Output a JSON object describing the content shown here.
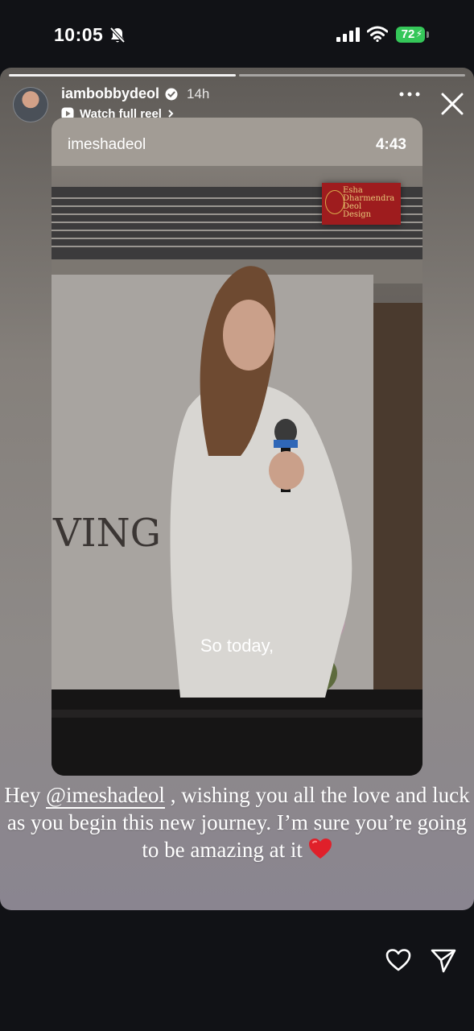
{
  "status_bar": {
    "time": "10:05",
    "battery": "72",
    "icons": [
      "bell-slash-icon",
      "cellular-signal-icon",
      "wifi-icon",
      "battery-charging-icon"
    ]
  },
  "story": {
    "username": "iambobbydeol",
    "verified": true,
    "time_ago": "14h",
    "watch_link": "Watch full reel",
    "progress": [
      1.0,
      0.0
    ],
    "reel": {
      "author": "imeshadeol",
      "duration": "4:43",
      "caption": "So today,",
      "logo_text": "Esha\nDharmendra\nDeol\nDesign"
    },
    "text": {
      "before": "Hey ",
      "mention": "@imeshadeol",
      "after": " , wishing you all the love and luck as you begin this new journey. I’m sure you’re going to be amazing at it"
    }
  },
  "colors": {
    "battery": "#35c759",
    "logo_red": "#9e1c1e",
    "heart": "#e0202a"
  },
  "bottom_bar": {
    "icons": [
      "heart-icon",
      "send-icon"
    ]
  }
}
